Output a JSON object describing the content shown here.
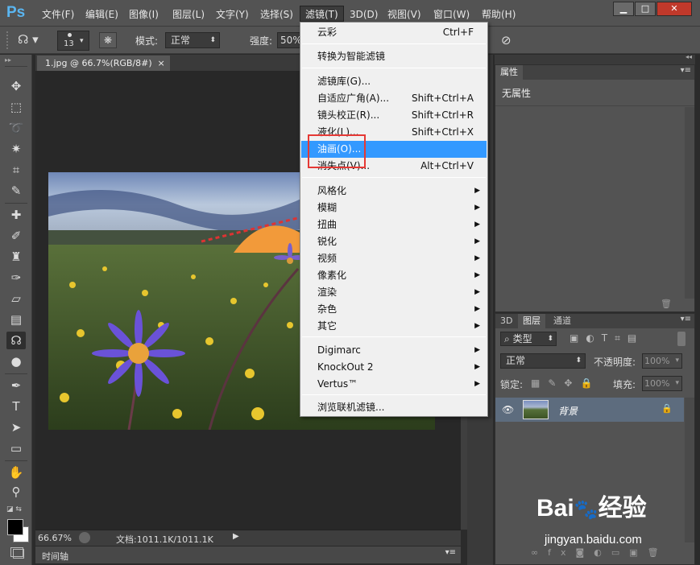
{
  "app": {
    "logo": "Ps"
  },
  "menu": [
    "文件(F)",
    "编辑(E)",
    "图像(I)",
    "图层(L)",
    "文字(Y)",
    "选择(S)",
    "滤镜(T)",
    "3D(D)",
    "视图(V)",
    "窗口(W)",
    "帮助(H)"
  ],
  "options": {
    "brush_size": "13",
    "mode_label": "模式:",
    "mode_value": "正常",
    "strength_label": "强度:",
    "strength_value": "50%"
  },
  "document": {
    "tab_title": "1.jpg @ 66.7%(RGB/8#)",
    "zoom": "66.67%",
    "doc_info": "文档:1011.1K/1011.1K",
    "timeline_label": "时间轴"
  },
  "filter_menu": {
    "items": [
      {
        "label": "云彩",
        "shortcut": "Ctrl+F"
      },
      {
        "label": "转换为智能滤镜",
        "shortcut": ""
      },
      {
        "label": "滤镜库(G)...",
        "shortcut": ""
      },
      {
        "label": "自适应广角(A)...",
        "shortcut": "Shift+Ctrl+A"
      },
      {
        "label": "镜头校正(R)...",
        "shortcut": "Shift+Ctrl+R"
      },
      {
        "label": "液化(L)...",
        "shortcut": "Shift+Ctrl+X"
      },
      {
        "label": "油画(O)...",
        "shortcut": ""
      },
      {
        "label": "消失点(V)...",
        "shortcut": "Alt+Ctrl+V"
      },
      {
        "label": "风格化",
        "shortcut": ""
      },
      {
        "label": "模糊",
        "shortcut": ""
      },
      {
        "label": "扭曲",
        "shortcut": ""
      },
      {
        "label": "锐化",
        "shortcut": ""
      },
      {
        "label": "视频",
        "shortcut": ""
      },
      {
        "label": "像素化",
        "shortcut": ""
      },
      {
        "label": "渲染",
        "shortcut": ""
      },
      {
        "label": "杂色",
        "shortcut": ""
      },
      {
        "label": "其它",
        "shortcut": ""
      },
      {
        "label": "Digimarc",
        "shortcut": ""
      },
      {
        "label": "KnockOut 2",
        "shortcut": ""
      },
      {
        "label": "Vertus™",
        "shortcut": ""
      },
      {
        "label": "浏览联机滤镜...",
        "shortcut": ""
      }
    ]
  },
  "properties": {
    "tab": "属性",
    "empty_text": "无属性"
  },
  "layers": {
    "tabs": [
      "3D",
      "图层",
      "通道"
    ],
    "filter_kind": "类型",
    "blend_mode": "正常",
    "opacity_label": "不透明度:",
    "opacity_value": "100%",
    "lock_label": "锁定:",
    "fill_label": "填充:",
    "fill_value": "100%",
    "layer_name": "背景"
  },
  "watermark": {
    "brand": "Bai",
    "brand2": "经验",
    "url": "jingyan.baidu.com"
  },
  "colors": {
    "highlight": "#3399ff",
    "annotation": "#e53935",
    "logo": "#5ab5f0"
  }
}
